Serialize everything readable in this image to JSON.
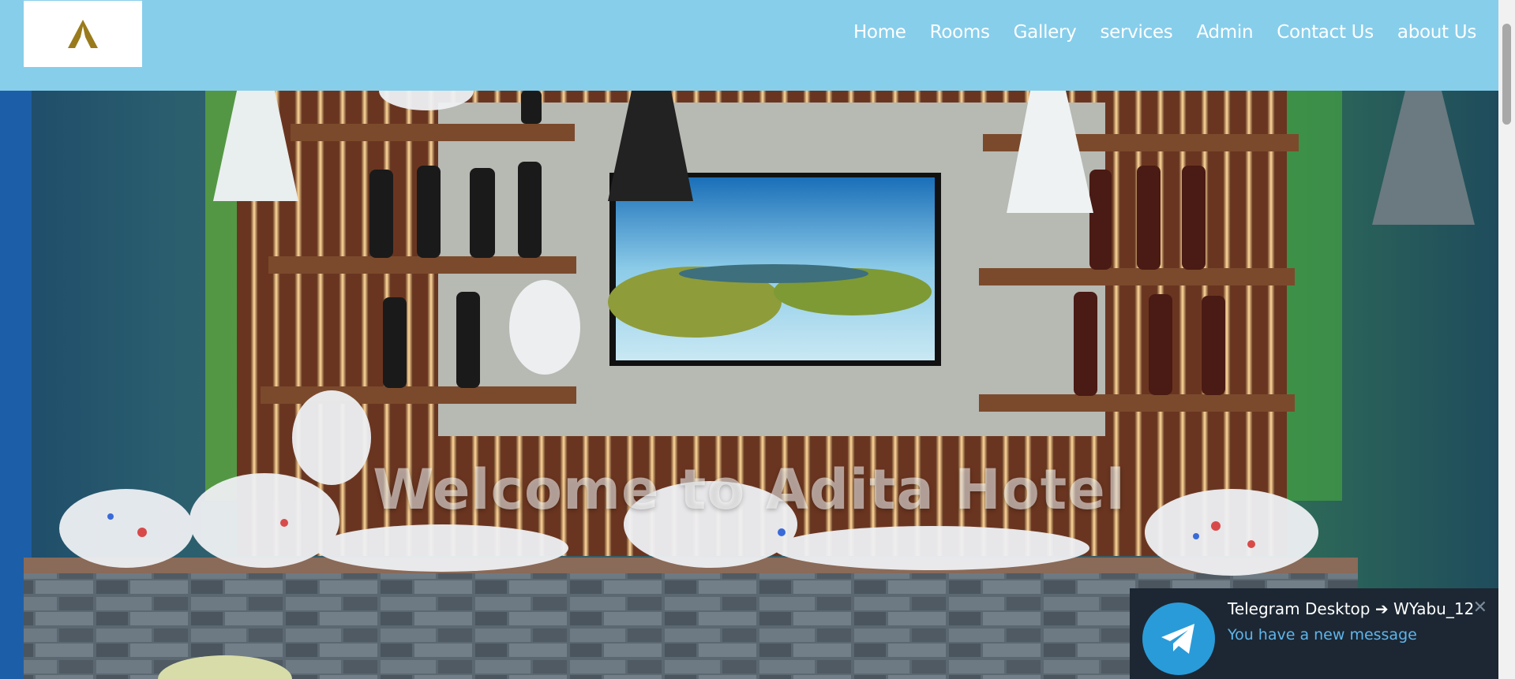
{
  "navbar": {
    "logo_icon": "hotel-logo-icon",
    "links": [
      "Home",
      "Rooms",
      "Gallery",
      "services",
      "Admin",
      "Contact Us",
      "about Us"
    ]
  },
  "hero": {
    "title": "Welcome to Adita Hotel"
  },
  "toast": {
    "icon": "telegram-icon",
    "title": "Telegram Desktop ➔ WYabu_12",
    "body": "You have a new message",
    "close_icon": "close-icon"
  },
  "colors": {
    "navbar_bg": "#87ceeb",
    "toast_bg": "#1c2733",
    "toast_link": "#5fb4ea",
    "logo_gold": "#9a7b1c"
  }
}
